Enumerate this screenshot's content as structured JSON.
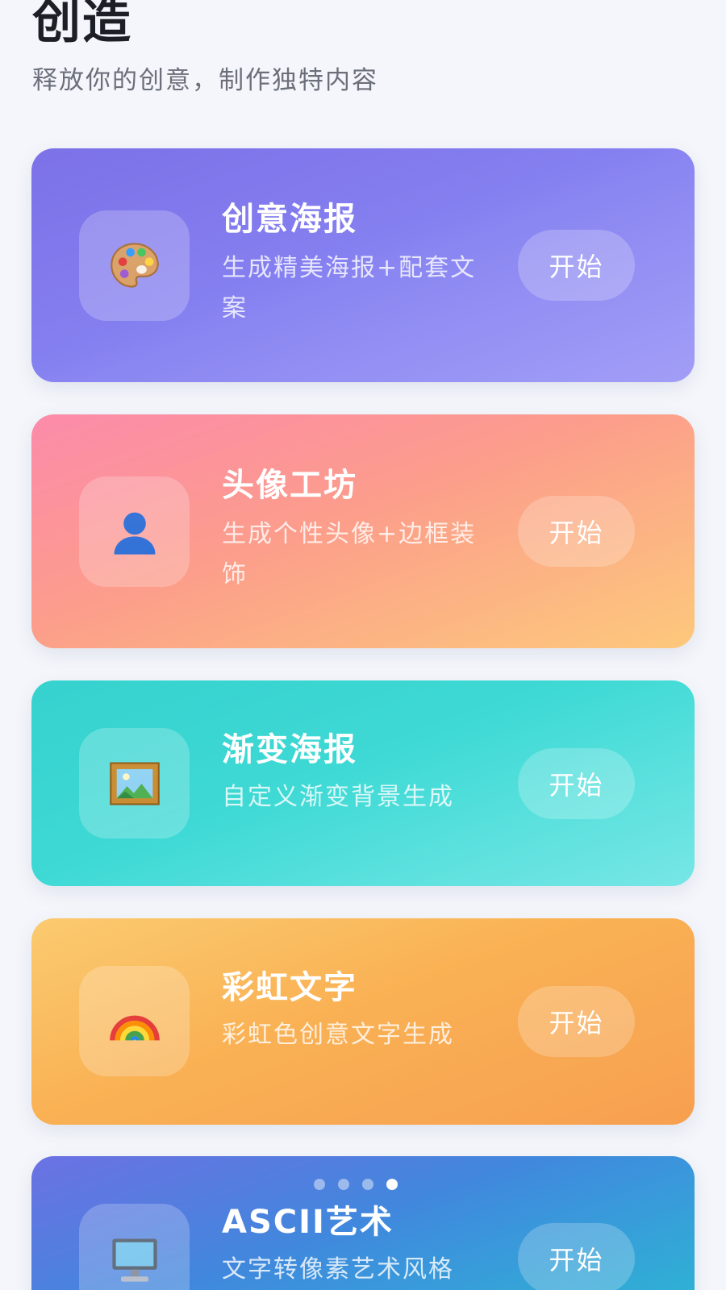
{
  "header": {
    "title": "创造",
    "subtitle": "释放你的创意，制作独特内容"
  },
  "cards": [
    {
      "title": "创意海报",
      "description": "生成精美海报+配套文案",
      "button_label": "开始",
      "icon": "palette-icon",
      "gradient": [
        "#6e62e6",
        "#9c98f7"
      ]
    },
    {
      "title": "头像工坊",
      "description": "生成个性头像+边框装饰",
      "button_label": "开始",
      "icon": "user-silhouette-icon",
      "gradient": [
        "#fc7ea0",
        "#fdc574"
      ]
    },
    {
      "title": "渐变海报",
      "description": "自定义渐变背景生成",
      "button_label": "开始",
      "icon": "framed-picture-icon",
      "gradient": [
        "#1fcdc9",
        "#6ee5e4"
      ]
    },
    {
      "title": "彩虹文字",
      "description": "彩虹色创意文字生成",
      "button_label": "开始",
      "icon": "rainbow-icon",
      "gradient": [
        "#fbc45f",
        "#f79a45"
      ]
    },
    {
      "title": "ASCII艺术",
      "description": "文字转像素艺术风格",
      "button_label": "开始",
      "icon": "desktop-computer-icon",
      "gradient": [
        "#5b62e0",
        "#1fb4d0"
      ]
    }
  ],
  "carousel": {
    "count": 4,
    "active_index": 3
  }
}
